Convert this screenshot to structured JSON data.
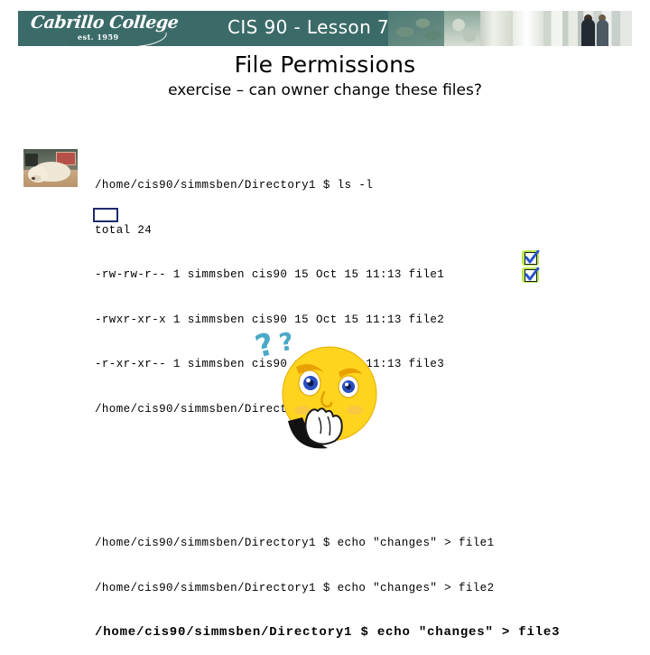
{
  "banner": {
    "logo_name": "Cabrillo College",
    "logo_est": "est. 1959",
    "title": "CIS 90 - Lesson 7",
    "bg_color": "#3b6b69"
  },
  "slide": {
    "title": "File Permissions",
    "subtitle": "exercise – can owner change these files?"
  },
  "terminal": {
    "lines": [
      "/home/cis90/simmsben/Directory1 $ ls -l",
      "total 24",
      "-rw-rw-r-- 1 simmsben cis90 15 Oct 15 11:13 file1",
      "-rwxr-xr-x 1 simmsben cis90 15 Oct 15 11:13 file2",
      "-r-xr-xr-- 1 simmsben cis90 15 Oct 15 11:13 file3",
      "/home/cis90/simmsben/Directory1 $"
    ],
    "command_lines": [
      "/home/cis90/simmsben/Directory1 $ echo \"changes\" > file1",
      "/home/cis90/simmsben/Directory1 $ echo \"changes\" > file2",
      "/home/cis90/simmsben/Directory1 $ echo \"changes\" > file3"
    ],
    "highlight": {
      "text": "r-x",
      "border_color": "#1f2a6e",
      "target_line": "-r-xr-xr-- 1 simmsben cis90 15 Oct 15 11:13 file3"
    }
  },
  "annotations": {
    "checkmarks": [
      {
        "name": "file1-check",
        "glow_color": "#b6e84a",
        "check_color": "#2a55c9"
      },
      {
        "name": "file2-check",
        "glow_color": "#b6e84a",
        "check_color": "#2a55c9"
      }
    ],
    "smiley": {
      "name": "thinking-smiley",
      "face_color": "#ffd41f",
      "question_mark_color": "#4aa8c8",
      "question_marks": "??"
    },
    "dog_photo": {
      "name": "dog-photo"
    }
  }
}
